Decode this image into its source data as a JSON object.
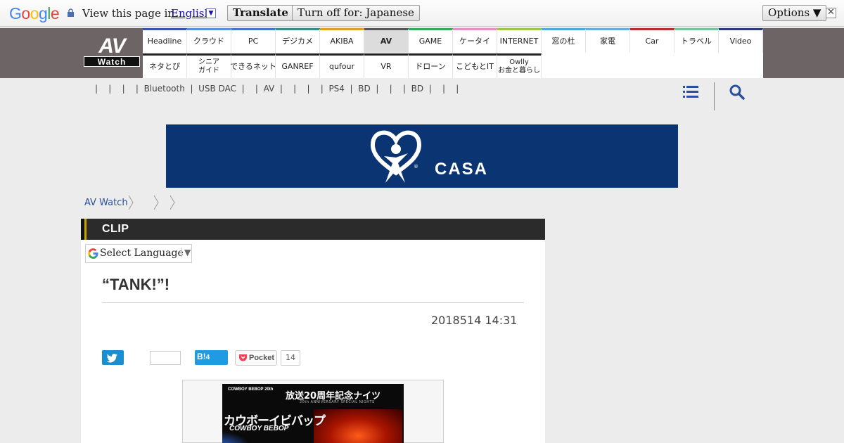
{
  "translate_bar": {
    "logo": "Google",
    "prompt": "View this page in:",
    "language": "English",
    "translate_label": "Translate",
    "turn_off_label": "Turn off for: Japanese",
    "options_label": "Options ▼",
    "close_symbol": "✕"
  },
  "site": {
    "logo_top": "AV",
    "logo_bottom": "Watch"
  },
  "nav": {
    "top": [
      {
        "label": "Headline",
        "color": "#3355aa"
      },
      {
        "label": "クラウド",
        "color": "#5a8fd8"
      },
      {
        "label": "PC",
        "color": "#4a73c9"
      },
      {
        "label": "デジカメ",
        "color": "#3a8b8b"
      },
      {
        "label": "AKIBA",
        "color": "#e0a020"
      },
      {
        "label": "AV",
        "color": "#555555",
        "active": true
      },
      {
        "label": "GAME",
        "color": "#3aa85a"
      },
      {
        "label": "ケータイ",
        "color": "#e68fc7"
      },
      {
        "label": "INTERNET",
        "color": "#98c74a"
      },
      {
        "label": "窓の杜",
        "color": "#4fa8d8"
      },
      {
        "label": "家電",
        "color": "#6aaad8"
      },
      {
        "label": "Car",
        "color": "#c0282e"
      },
      {
        "label": "トラベル",
        "color": "#79c29a"
      },
      {
        "label": "Video",
        "color": "#2a3a7a"
      }
    ],
    "bottom": [
      {
        "label": "ネタとぴ"
      },
      {
        "label": "シニア\nガイド"
      },
      {
        "label": "できるネット"
      },
      {
        "label": "GANREF"
      },
      {
        "label": "qufour"
      },
      {
        "label": "VR"
      },
      {
        "label": "ドローン"
      },
      {
        "label": "こどもとIT"
      },
      {
        "label": "Owlly\nお金と暮らし"
      }
    ]
  },
  "subnav": {
    "text": "|    |    |    |  Bluetooth  |  USB DAC  |    |  AV  |    |    |    |  PS4  |  BD  |    |    |  BD  |    |    |"
  },
  "banner": {
    "brand": "CASA",
    "reg_mark": "®"
  },
  "breadcrumb": {
    "home": "AV Watch"
  },
  "article": {
    "section": "CLIP",
    "select_language": "Select Language",
    "select_arrow": "▼",
    "title": "“TANK!”!",
    "date": "2018514 14:31",
    "hatena_label": "B!",
    "hatena_count": "4",
    "pocket_label": "Pocket",
    "pocket_count": "14"
  },
  "photo": {
    "logo_small": "COWBOY BEBOP 20th",
    "headline": "放送20周年記念ナイツ",
    "subline": "20th ANNIVERSARY SPECIAL NIGHTS",
    "title_jp": "カウボーイビバップ",
    "title_en": "COWBOY BEBOP"
  }
}
